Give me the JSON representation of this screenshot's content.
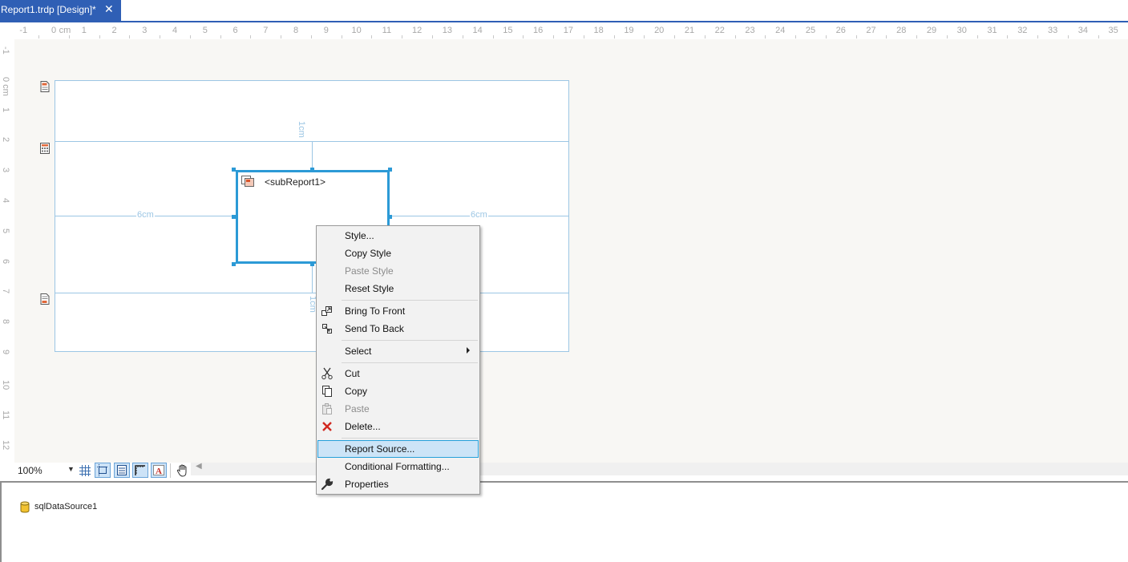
{
  "tab": {
    "title": "Report1.trdp [Design]*",
    "close_glyph": "✕"
  },
  "ruler": {
    "unit_label": "cm",
    "h_labels": [
      "-1",
      "0",
      "1",
      "2",
      "3",
      "4",
      "5",
      "6",
      "7",
      "8",
      "9",
      "10",
      "11",
      "12",
      "13",
      "14",
      "15",
      "16",
      "17",
      "18",
      "19",
      "20",
      "21",
      "22",
      "23",
      "24",
      "25",
      "26",
      "27",
      "28",
      "29",
      "30",
      "31",
      "32",
      "33",
      "34",
      "35"
    ],
    "v_labels": [
      "-1",
      "0 cm",
      "1",
      "2",
      "3",
      "4",
      "5",
      "6",
      "7",
      "8",
      "9",
      "10",
      "11",
      "12"
    ]
  },
  "design": {
    "subreport_label": "<subReport1>",
    "guide_labels": {
      "top": "1cm",
      "bottom": "1cm",
      "left": "6cm",
      "right": "6cm"
    },
    "section_icons": [
      "page-header-icon",
      "report-body-icon",
      "page-footer-icon"
    ]
  },
  "toolbar": {
    "zoom_value": "100%",
    "buttons": [
      "grid-icon",
      "snap-to-grid-icon",
      "snap-to-bands-icon",
      "dimensions-icon",
      "text-style-icon",
      "pan-hand-icon"
    ]
  },
  "tray": {
    "datasource_label": "sqlDataSource1"
  },
  "context_menu": {
    "items": [
      {
        "label": "Style...",
        "icon": "",
        "disabled": false
      },
      {
        "label": "Copy Style",
        "icon": "",
        "disabled": false
      },
      {
        "label": "Paste Style",
        "icon": "",
        "disabled": true
      },
      {
        "label": "Reset Style",
        "icon": "",
        "disabled": false
      },
      {
        "label": "Bring To Front",
        "icon": "bring-to-front-icon",
        "disabled": false
      },
      {
        "label": "Send To Back",
        "icon": "send-to-back-icon",
        "disabled": false
      },
      {
        "label": "Select",
        "icon": "",
        "disabled": false,
        "has_submenu": true
      },
      {
        "label": "Cut",
        "icon": "cut-icon",
        "disabled": false
      },
      {
        "label": "Copy",
        "icon": "copy-icon",
        "disabled": false
      },
      {
        "label": "Paste",
        "icon": "paste-icon",
        "disabled": true
      },
      {
        "label": "Delete...",
        "icon": "delete-icon",
        "disabled": false
      },
      {
        "label": "Report Source...",
        "icon": "",
        "disabled": false,
        "highlighted": true
      },
      {
        "label": "Conditional Formatting...",
        "icon": "",
        "disabled": false
      },
      {
        "label": "Properties",
        "icon": "properties-icon",
        "disabled": false
      }
    ]
  },
  "colors": {
    "accent": "#2f5fb5",
    "selection": "#2c9ad6",
    "guide": "#9cc6e4",
    "menu_highlight": "#cce4f7"
  }
}
